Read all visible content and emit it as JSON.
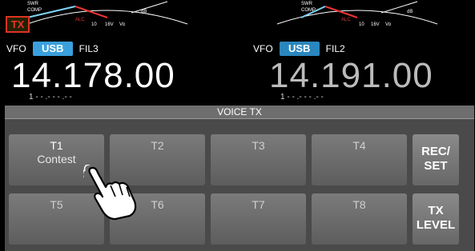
{
  "left": {
    "meter": {
      "swr": "SWR",
      "comp": "COMP",
      "alc": "ALC",
      "scale_10": "10",
      "scale_16v": "16V",
      "vd": "Vᴅ",
      "db": "dB"
    },
    "tx_badge": "TX",
    "vfo_label": "VFO",
    "mode": "USB",
    "filter": "FIL3",
    "frequency": "14.178.00",
    "sub_readout": "1 - - .- - - .- -"
  },
  "right": {
    "meter": {
      "swr": "SWR",
      "comp": "COMP",
      "alc": "ALC",
      "scale_10": "10",
      "scale_16v": "16V",
      "vd": "Vᴅ",
      "db": "dB"
    },
    "vfo_label": "VFO",
    "mode": "USB",
    "filter": "FIL2",
    "frequency": "14.191.00",
    "sub_readout": "1 - - .- - - .- -"
  },
  "panel": {
    "title": "VOICE TX",
    "keys": [
      {
        "label": "T1",
        "sub": "Contest"
      },
      {
        "label": "T2"
      },
      {
        "label": "T3"
      },
      {
        "label": "T4"
      },
      {
        "label": "T5"
      },
      {
        "label": "T6"
      },
      {
        "label": "T7"
      },
      {
        "label": "T8"
      }
    ],
    "rec_set": [
      "REC/",
      "SET"
    ],
    "tx_level": [
      "TX",
      "LEVEL"
    ]
  },
  "colors": {
    "mode_button": "#3aa0dd",
    "tx_badge": "#e33",
    "panel": "#4a4a4a"
  }
}
